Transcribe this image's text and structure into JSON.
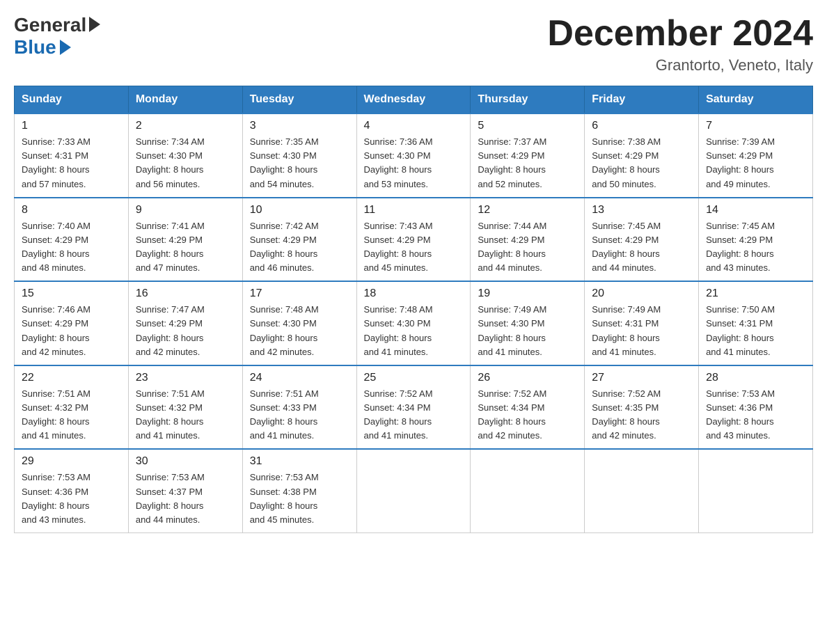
{
  "logo": {
    "general": "General",
    "blue": "Blue"
  },
  "header": {
    "month": "December 2024",
    "location": "Grantorto, Veneto, Italy"
  },
  "days_of_week": [
    "Sunday",
    "Monday",
    "Tuesday",
    "Wednesday",
    "Thursday",
    "Friday",
    "Saturday"
  ],
  "weeks": [
    [
      {
        "day": "1",
        "sunrise": "7:33 AM",
        "sunset": "4:31 PM",
        "daylight": "8 hours and 57 minutes."
      },
      {
        "day": "2",
        "sunrise": "7:34 AM",
        "sunset": "4:30 PM",
        "daylight": "8 hours and 56 minutes."
      },
      {
        "day": "3",
        "sunrise": "7:35 AM",
        "sunset": "4:30 PM",
        "daylight": "8 hours and 54 minutes."
      },
      {
        "day": "4",
        "sunrise": "7:36 AM",
        "sunset": "4:30 PM",
        "daylight": "8 hours and 53 minutes."
      },
      {
        "day": "5",
        "sunrise": "7:37 AM",
        "sunset": "4:29 PM",
        "daylight": "8 hours and 52 minutes."
      },
      {
        "day": "6",
        "sunrise": "7:38 AM",
        "sunset": "4:29 PM",
        "daylight": "8 hours and 50 minutes."
      },
      {
        "day": "7",
        "sunrise": "7:39 AM",
        "sunset": "4:29 PM",
        "daylight": "8 hours and 49 minutes."
      }
    ],
    [
      {
        "day": "8",
        "sunrise": "7:40 AM",
        "sunset": "4:29 PM",
        "daylight": "8 hours and 48 minutes."
      },
      {
        "day": "9",
        "sunrise": "7:41 AM",
        "sunset": "4:29 PM",
        "daylight": "8 hours and 47 minutes."
      },
      {
        "day": "10",
        "sunrise": "7:42 AM",
        "sunset": "4:29 PM",
        "daylight": "8 hours and 46 minutes."
      },
      {
        "day": "11",
        "sunrise": "7:43 AM",
        "sunset": "4:29 PM",
        "daylight": "8 hours and 45 minutes."
      },
      {
        "day": "12",
        "sunrise": "7:44 AM",
        "sunset": "4:29 PM",
        "daylight": "8 hours and 44 minutes."
      },
      {
        "day": "13",
        "sunrise": "7:45 AM",
        "sunset": "4:29 PM",
        "daylight": "8 hours and 44 minutes."
      },
      {
        "day": "14",
        "sunrise": "7:45 AM",
        "sunset": "4:29 PM",
        "daylight": "8 hours and 43 minutes."
      }
    ],
    [
      {
        "day": "15",
        "sunrise": "7:46 AM",
        "sunset": "4:29 PM",
        "daylight": "8 hours and 42 minutes."
      },
      {
        "day": "16",
        "sunrise": "7:47 AM",
        "sunset": "4:29 PM",
        "daylight": "8 hours and 42 minutes."
      },
      {
        "day": "17",
        "sunrise": "7:48 AM",
        "sunset": "4:30 PM",
        "daylight": "8 hours and 42 minutes."
      },
      {
        "day": "18",
        "sunrise": "7:48 AM",
        "sunset": "4:30 PM",
        "daylight": "8 hours and 41 minutes."
      },
      {
        "day": "19",
        "sunrise": "7:49 AM",
        "sunset": "4:30 PM",
        "daylight": "8 hours and 41 minutes."
      },
      {
        "day": "20",
        "sunrise": "7:49 AM",
        "sunset": "4:31 PM",
        "daylight": "8 hours and 41 minutes."
      },
      {
        "day": "21",
        "sunrise": "7:50 AM",
        "sunset": "4:31 PM",
        "daylight": "8 hours and 41 minutes."
      }
    ],
    [
      {
        "day": "22",
        "sunrise": "7:51 AM",
        "sunset": "4:32 PM",
        "daylight": "8 hours and 41 minutes."
      },
      {
        "day": "23",
        "sunrise": "7:51 AM",
        "sunset": "4:32 PM",
        "daylight": "8 hours and 41 minutes."
      },
      {
        "day": "24",
        "sunrise": "7:51 AM",
        "sunset": "4:33 PM",
        "daylight": "8 hours and 41 minutes."
      },
      {
        "day": "25",
        "sunrise": "7:52 AM",
        "sunset": "4:34 PM",
        "daylight": "8 hours and 41 minutes."
      },
      {
        "day": "26",
        "sunrise": "7:52 AM",
        "sunset": "4:34 PM",
        "daylight": "8 hours and 42 minutes."
      },
      {
        "day": "27",
        "sunrise": "7:52 AM",
        "sunset": "4:35 PM",
        "daylight": "8 hours and 42 minutes."
      },
      {
        "day": "28",
        "sunrise": "7:53 AM",
        "sunset": "4:36 PM",
        "daylight": "8 hours and 43 minutes."
      }
    ],
    [
      {
        "day": "29",
        "sunrise": "7:53 AM",
        "sunset": "4:36 PM",
        "daylight": "8 hours and 43 minutes."
      },
      {
        "day": "30",
        "sunrise": "7:53 AM",
        "sunset": "4:37 PM",
        "daylight": "8 hours and 44 minutes."
      },
      {
        "day": "31",
        "sunrise": "7:53 AM",
        "sunset": "4:38 PM",
        "daylight": "8 hours and 45 minutes."
      },
      null,
      null,
      null,
      null
    ]
  ],
  "labels": {
    "sunrise": "Sunrise:",
    "sunset": "Sunset:",
    "daylight": "Daylight:"
  }
}
